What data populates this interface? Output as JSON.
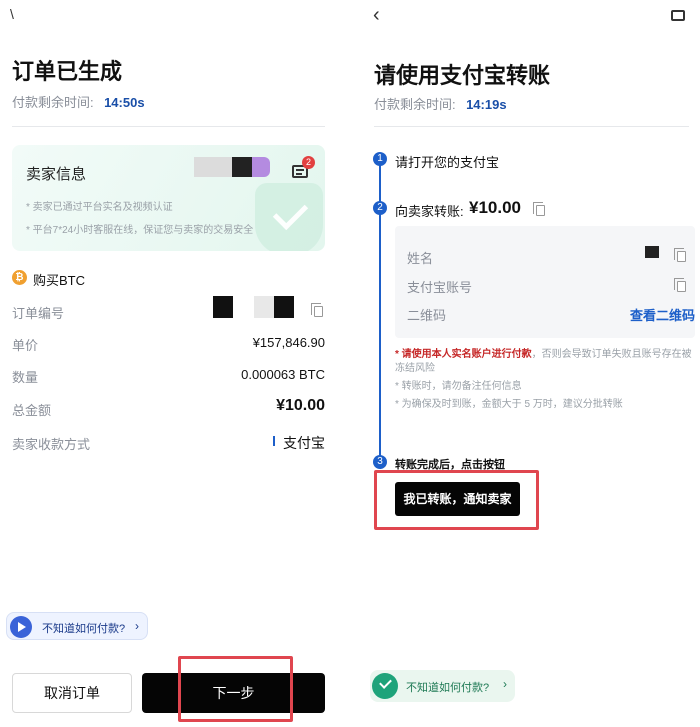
{
  "left": {
    "back_glyph": "\\",
    "title": "订单已生成",
    "timer_label": "付款剩余时间:",
    "timer_value": "14:50s",
    "seller_card": {
      "title": "卖家信息",
      "badge_count": "2",
      "note1": "* 卖家已通过平台实名及视频认证",
      "note2": "* 平台7*24小时客服在线，保证您与卖家的交易安全"
    },
    "buy_title": "购买BTC",
    "btc_symbol": "₿",
    "rows": [
      {
        "label": "订单编号",
        "value": ""
      },
      {
        "label": "单价",
        "value": "¥157,846.90"
      },
      {
        "label": "数量",
        "value": "0.000063 BTC"
      },
      {
        "label": "总金额",
        "value": "¥10.00"
      },
      {
        "label": "卖家收款方式",
        "value": "支付宝"
      }
    ],
    "help_text": "不知道如何付款?",
    "help_chevron": "›",
    "cancel_label": "取消订单",
    "next_label": "下一步"
  },
  "right": {
    "back_glyph": "‹",
    "title": "请使用支付宝转账",
    "timer_label": "付款剩余时间:",
    "timer_value": "14:19s",
    "step1_num": "1",
    "step1_text": "请打开您的支付宝",
    "step2_num": "2",
    "step2_text": "向卖家转账:",
    "step2_amount": "¥10.00",
    "info_rows": [
      {
        "label": "姓名"
      },
      {
        "label": "支付宝账号"
      },
      {
        "label": "二维码",
        "link": "查看二维码"
      }
    ],
    "note1_highlight": "* 请使用本人实名账户进行付款",
    "note1_rest": "，否则会导致订单失败且账号存在被冻结风险",
    "note2": "* 转账时，请勿备注任何信息",
    "note3": "* 为确保及时到账，金额大于 5 万时，建议分批转账",
    "step3_num": "3",
    "step3_text": "转账完成后，点击按钮",
    "notify_label": "我已转账，通知卖家",
    "help_text": "不知道如何付款?",
    "help_chevron": "›"
  },
  "colors": {
    "accent_blue": "#1d5fc9",
    "highlight_red": "#e0464f",
    "primary_button": "#050505"
  }
}
